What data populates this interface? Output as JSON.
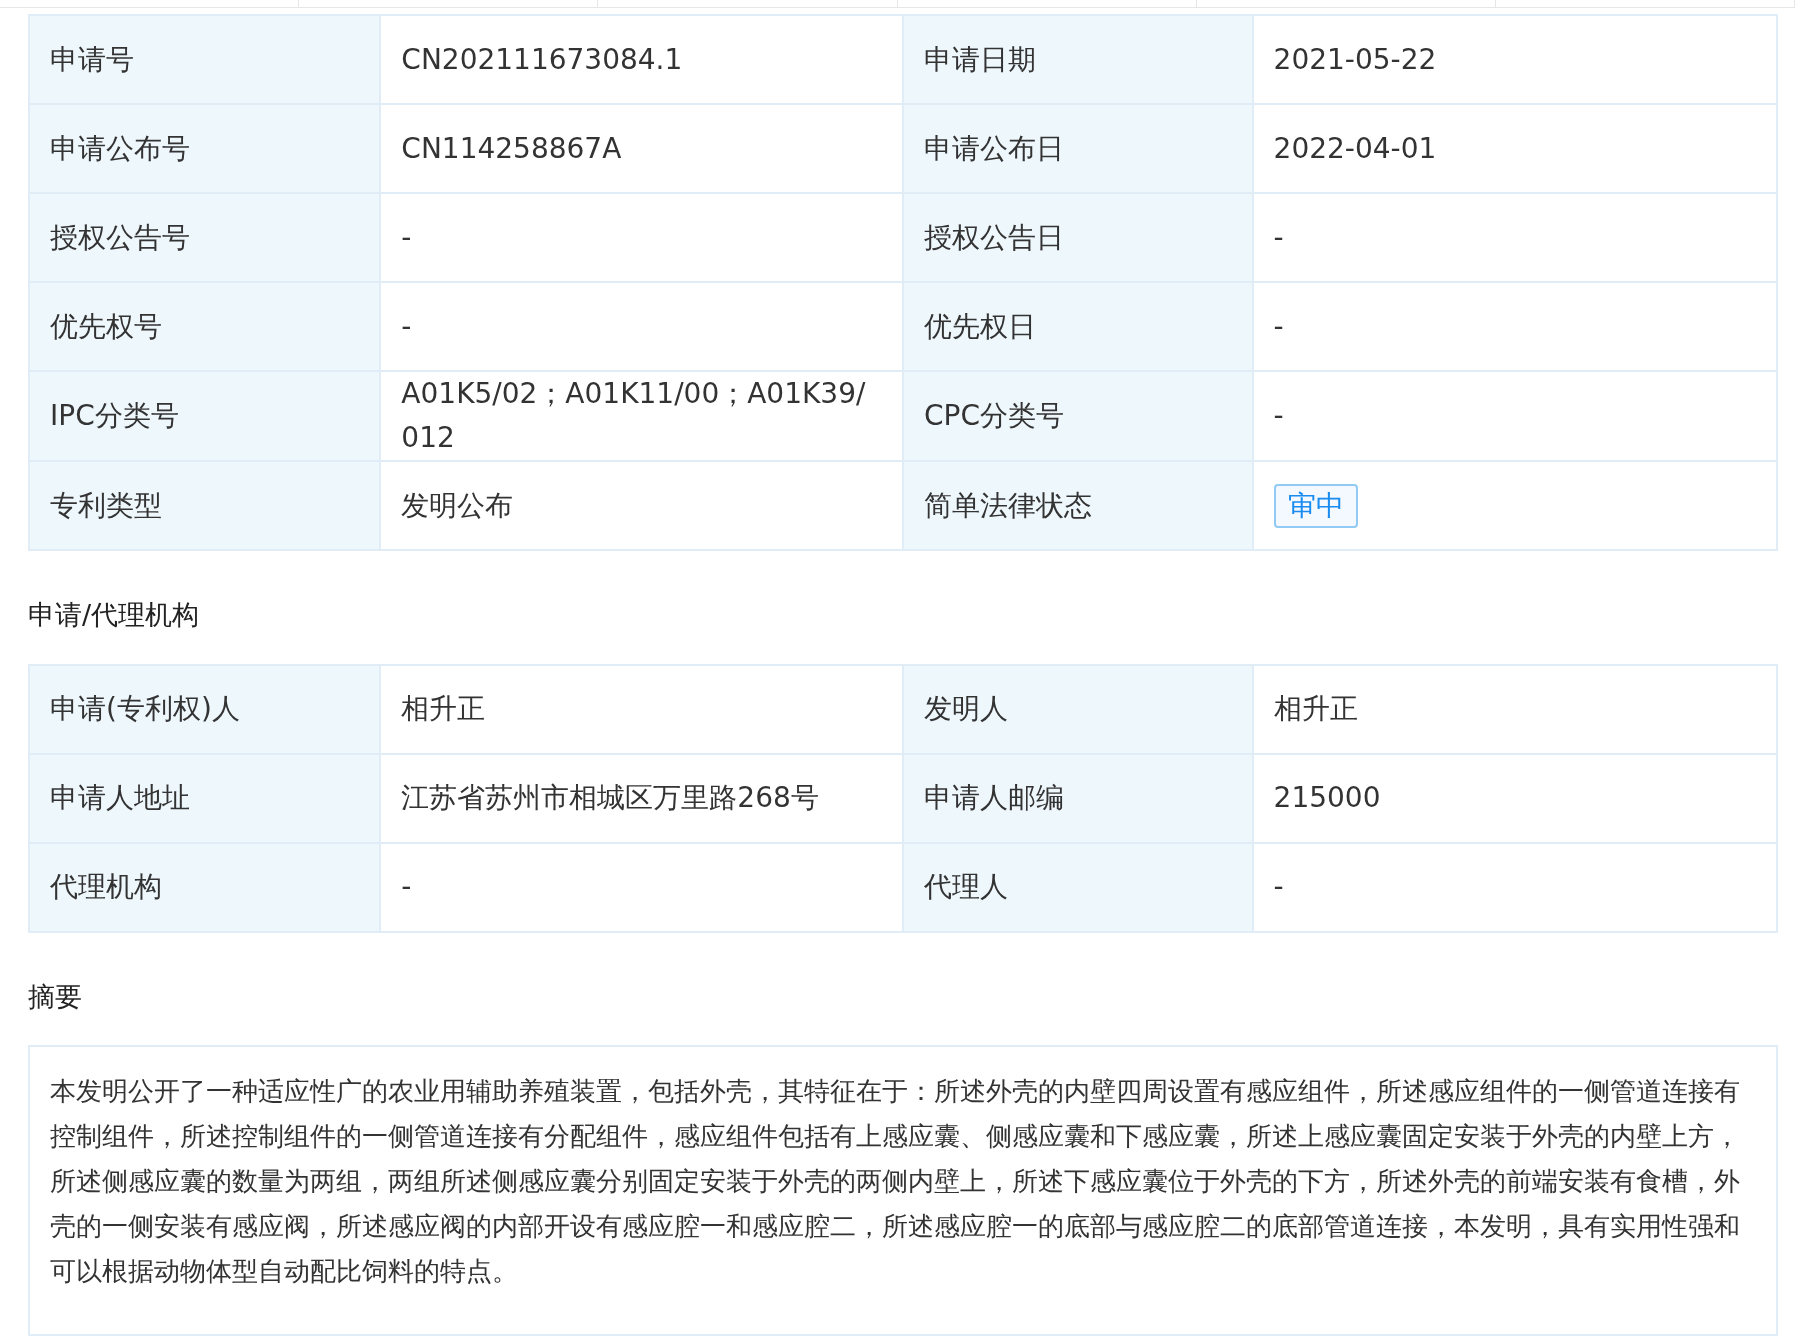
{
  "basic_info": {
    "rows": [
      [
        {
          "label": "申请号",
          "value": "CN202111673084.1",
          "kind": "text"
        },
        {
          "label": "申请日期",
          "value": "2021-05-22",
          "kind": "text"
        }
      ],
      [
        {
          "label": "申请公布号",
          "value": "CN114258867A",
          "kind": "text"
        },
        {
          "label": "申请公布日",
          "value": "2022-04-01",
          "kind": "text"
        }
      ],
      [
        {
          "label": "授权公告号",
          "value": "-",
          "kind": "text"
        },
        {
          "label": "授权公告日",
          "value": "-",
          "kind": "text"
        }
      ],
      [
        {
          "label": "优先权号",
          "value": "-",
          "kind": "text"
        },
        {
          "label": "优先权日",
          "value": "-",
          "kind": "text"
        }
      ],
      [
        {
          "label": "IPC分类号",
          "value": "A01K5/02；A01K11/00；A01K39/012",
          "kind": "text"
        },
        {
          "label": "CPC分类号",
          "value": "-",
          "kind": "text"
        }
      ],
      [
        {
          "label": "专利类型",
          "value": "发明公布",
          "kind": "text"
        },
        {
          "label": "简单法律状态",
          "value": "审中",
          "kind": "tag"
        }
      ]
    ]
  },
  "agency": {
    "title": "申请/代理机构",
    "rows": [
      [
        {
          "label": "申请(专利权)人",
          "value": "相升正",
          "kind": "text"
        },
        {
          "label": "发明人",
          "value": "相升正",
          "kind": "text"
        }
      ],
      [
        {
          "label": "申请人地址",
          "value": "江苏省苏州市相城区万里路268号",
          "kind": "text"
        },
        {
          "label": "申请人邮编",
          "value": "215000",
          "kind": "text"
        }
      ],
      [
        {
          "label": "代理机构",
          "value": "-",
          "kind": "text"
        },
        {
          "label": "代理人",
          "value": "-",
          "kind": "text"
        }
      ]
    ]
  },
  "abstract": {
    "title": "摘要",
    "text": "本发明公开了一种适应性广的农业用辅助养殖装置，包括外壳，其特征在于：所述外壳的内壁四周设置有感应组件，所述感应组件的一侧管道连接有控制组件，所述控制组件的一侧管道连接有分配组件，感应组件包括有上感应囊、侧感应囊和下感应囊，所述上感应囊固定安装于外壳的内壁上方，所述侧感应囊的数量为两组，两组所述侧感应囊分别固定安装于外壳的两侧内壁上，所述下感应囊位于外壳的下方，所述外壳的前端安装有食槽，外壳的一侧安装有感应阀，所述感应阀的内部开设有感应腔一和感应腔二，所述感应腔一的底部与感应腔二的底部管道连接，本发明，具有实用性强和可以根据动物体型自动配比饲料的特点。"
  }
}
